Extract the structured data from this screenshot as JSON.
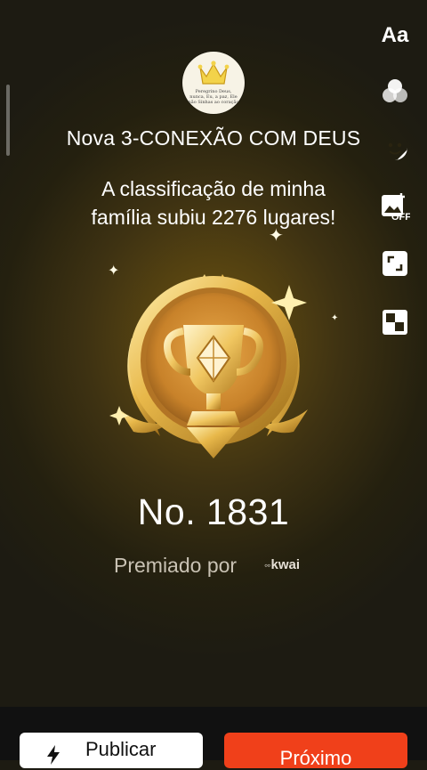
{
  "group": {
    "name": "Nova 3-CONEXÃO COM DEUS",
    "avatar_text": "Peregrino Deus, nunca, Eu, a paz, Ele não Sinhas ao coração"
  },
  "headline": {
    "line1": "A classificação de minha",
    "line2": "família subiu 2276 lugares!"
  },
  "rank": {
    "label": "No. 1831",
    "position": 1831,
    "places_climbed": 2276
  },
  "awarded": {
    "label": "Premiado por",
    "brand": "kwai",
    "brand_icon": "kwai-logo-icon"
  },
  "toolbar": {
    "text_label": "Aa",
    "items": [
      "text-icon",
      "color-filter-icon",
      "sticker-icon",
      "image-off-icon",
      "crop-icon",
      "mosaic-icon"
    ],
    "image_off_badge": "OFF"
  },
  "actions": {
    "publish_label": "Publicar",
    "next_label": "Próximo"
  },
  "colors": {
    "accent": "#f0401a",
    "gold": "#e8b84a",
    "background": "#2a2410"
  }
}
